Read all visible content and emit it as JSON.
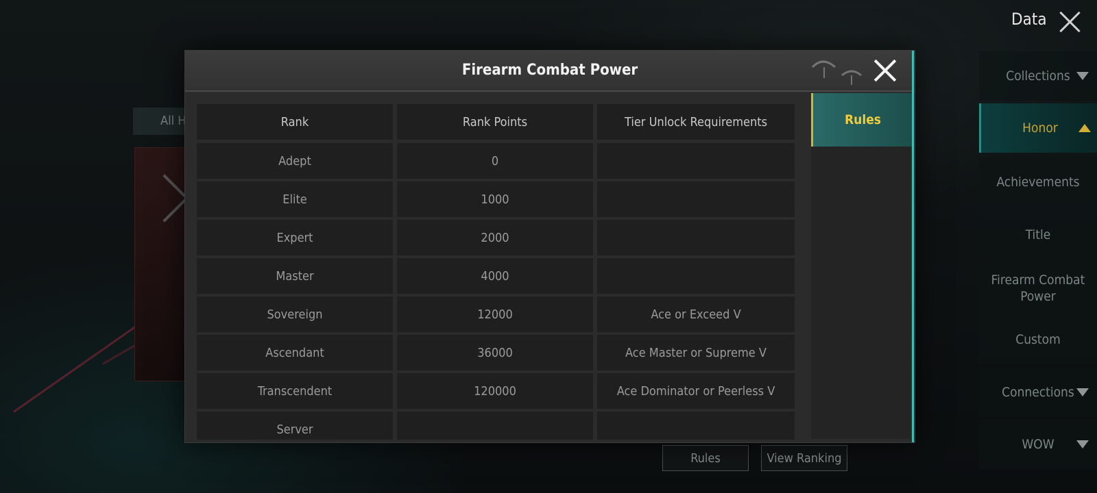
{
  "screen": {
    "title": "Data",
    "sidebar": {
      "items": [
        {
          "label": "Collections"
        },
        {
          "label": "Honor"
        },
        {
          "label": "Achievements"
        },
        {
          "label": "Title"
        },
        {
          "label": "Firearm Combat Power"
        },
        {
          "label": "Custom"
        },
        {
          "label": "Connections"
        },
        {
          "label": "WOW"
        }
      ]
    },
    "background": {
      "tab_partial": "All H",
      "buttons": {
        "rules": "Rules",
        "view_ranking": "View Ranking"
      }
    }
  },
  "dialog": {
    "title": "Firearm Combat Power",
    "side_tab": "Rules",
    "table": {
      "headers": [
        "Rank",
        "Rank Points",
        "Tier Unlock Requirements"
      ],
      "rows": [
        [
          "Adept",
          "0",
          ""
        ],
        [
          "Elite",
          "1000",
          ""
        ],
        [
          "Expert",
          "2000",
          ""
        ],
        [
          "Master",
          "4000",
          ""
        ],
        [
          "Sovereign",
          "12000",
          "Ace or Exceed V"
        ],
        [
          "Ascendant",
          "36000",
          "Ace Master or Supreme V"
        ],
        [
          "Transcendent",
          "120000",
          "Ace Dominator or Peerless V"
        ],
        [
          "Server",
          "",
          ""
        ]
      ]
    }
  },
  "colors": {
    "accent_gold": "#d8b435",
    "accent_teal": "#3fbcb3",
    "panel": "#2b2b2b",
    "cell": "#1f1f1f"
  },
  "icons": [
    "close-icon",
    "chevron-down-icon",
    "chevron-up-icon",
    "parachute-icon"
  ]
}
